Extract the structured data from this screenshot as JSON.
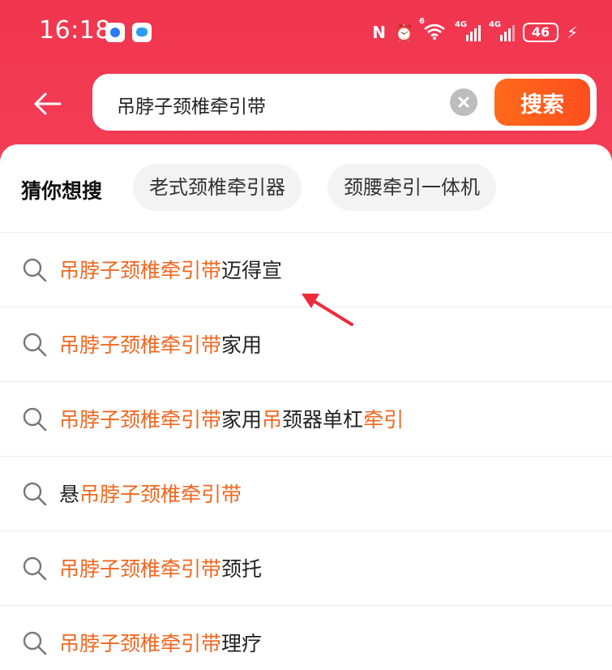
{
  "status_bar": {
    "time": "16:18",
    "signal1_label": "4G",
    "signal2_label": "4G",
    "wifi_label": "6",
    "battery": "46"
  },
  "search": {
    "query": "吊脖子颈椎牵引带",
    "button_label": "搜索"
  },
  "guess": {
    "title": "猜你想搜",
    "chips": [
      "老式颈椎牵引器",
      "颈腰牵引一体机"
    ]
  },
  "suggestions": [
    [
      {
        "t": "吊脖子颈椎牵引带",
        "h": true
      },
      {
        "t": "迈得宣",
        "h": false
      }
    ],
    [
      {
        "t": "吊脖子颈椎牵引带",
        "h": true
      },
      {
        "t": "家用",
        "h": false
      }
    ],
    [
      {
        "t": "吊脖子颈椎牵引带",
        "h": true
      },
      {
        "t": "家用",
        "h": false
      },
      {
        "t": "吊",
        "h": true
      },
      {
        "t": "颈器单杠",
        "h": false
      },
      {
        "t": "牵引",
        "h": true
      }
    ],
    [
      {
        "t": "悬",
        "h": false
      },
      {
        "t": "吊脖子颈椎牵引带",
        "h": true
      }
    ],
    [
      {
        "t": "吊脖子颈椎牵引带",
        "h": true
      },
      {
        "t": "颈托",
        "h": false
      }
    ],
    [
      {
        "t": "吊脖子颈椎牵引带",
        "h": true
      },
      {
        "t": "理疗",
        "h": false
      }
    ]
  ],
  "colors": {
    "header_red": "#f0364e",
    "search_button": "#ff5a1c",
    "highlight": "#f2661f",
    "annotation_arrow": "#ee2a3a"
  }
}
